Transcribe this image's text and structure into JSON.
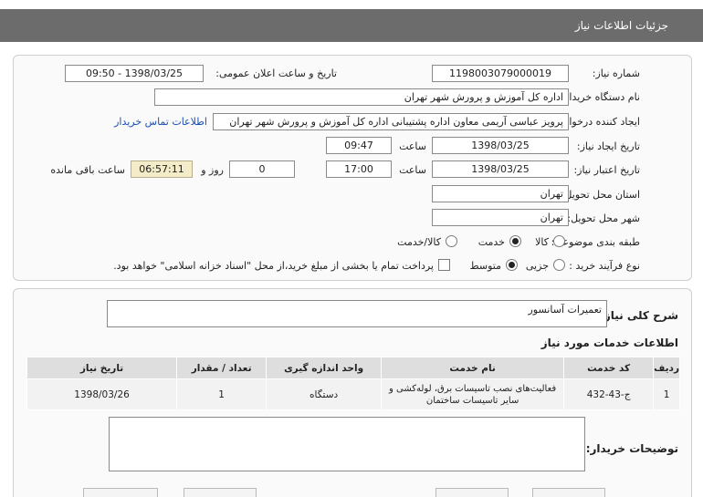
{
  "page": {
    "title": "جزئیات اطلاعات نیاز"
  },
  "form": {
    "need_number": {
      "label": "شماره نیاز:",
      "value": "1198003079000019"
    },
    "announce": {
      "label": "تاریخ و ساعت اعلان عمومی:",
      "value": "1398/03/25 - 09:50"
    },
    "buyer": {
      "label": "نام دستگاه خریدار:",
      "value": "اداره کل آموزش و پرورش شهر تهران"
    },
    "requester": {
      "label": "ایجاد کننده درخواست:",
      "value": "پرویز عباسی آریمی  معاون اداره پشتیبانی  اداره کل آموزش و پرورش شهر تهران",
      "contact_link": "اطلاعات تماس خریدار"
    },
    "created": {
      "label": "تاریخ ایجاد نیاز:",
      "date": "1398/03/25",
      "time_label": "ساعت",
      "time": "09:47"
    },
    "validity": {
      "label": "تاریخ اعتبار نیاز:",
      "date": "1398/03/25",
      "time_label": "ساعت",
      "time": "17:00",
      "days": "0",
      "days_label": "روز و",
      "remaining": "06:57:11",
      "remaining_label": "ساعت باقی مانده"
    },
    "province": {
      "label": "استان محل تحویل:",
      "value": "تهران"
    },
    "city": {
      "label": "شهر محل تحویل:",
      "value": "تهران"
    },
    "category": {
      "label": "طبقه بندی موضوعی:",
      "options": [
        "کالا",
        "خدمت",
        "کالا/خدمت"
      ],
      "selected": "خدمت"
    },
    "process": {
      "label": "نوع فرآیند خرید :",
      "options": [
        "جزیی",
        "متوسط"
      ],
      "selected": "متوسط",
      "note": "پرداخت تمام یا بخشی از مبلغ خرید،از محل \"اسناد خزانه اسلامی\" خواهد بود."
    }
  },
  "description": {
    "label": "شرح کلی نیاز:",
    "value": "تعمیرات آسانسور"
  },
  "services": {
    "heading": "اطلاعات خدمات مورد نیاز",
    "columns": [
      "ردیف",
      "کد خدمت",
      "نام خدمت",
      "واحد اندازه گیری",
      "تعداد / مقدار",
      "تاریخ نیاز"
    ],
    "rows": [
      [
        "1",
        "ج-43-432",
        "فعالیت‌های نصب تاسیسات برق، لوله‌کشی و سایر تاسیسات ساختمان",
        "دستگاه",
        "1",
        "1398/03/26"
      ]
    ]
  },
  "buyer_notes": {
    "label": "توضیحات خریدار:",
    "value": ""
  }
}
